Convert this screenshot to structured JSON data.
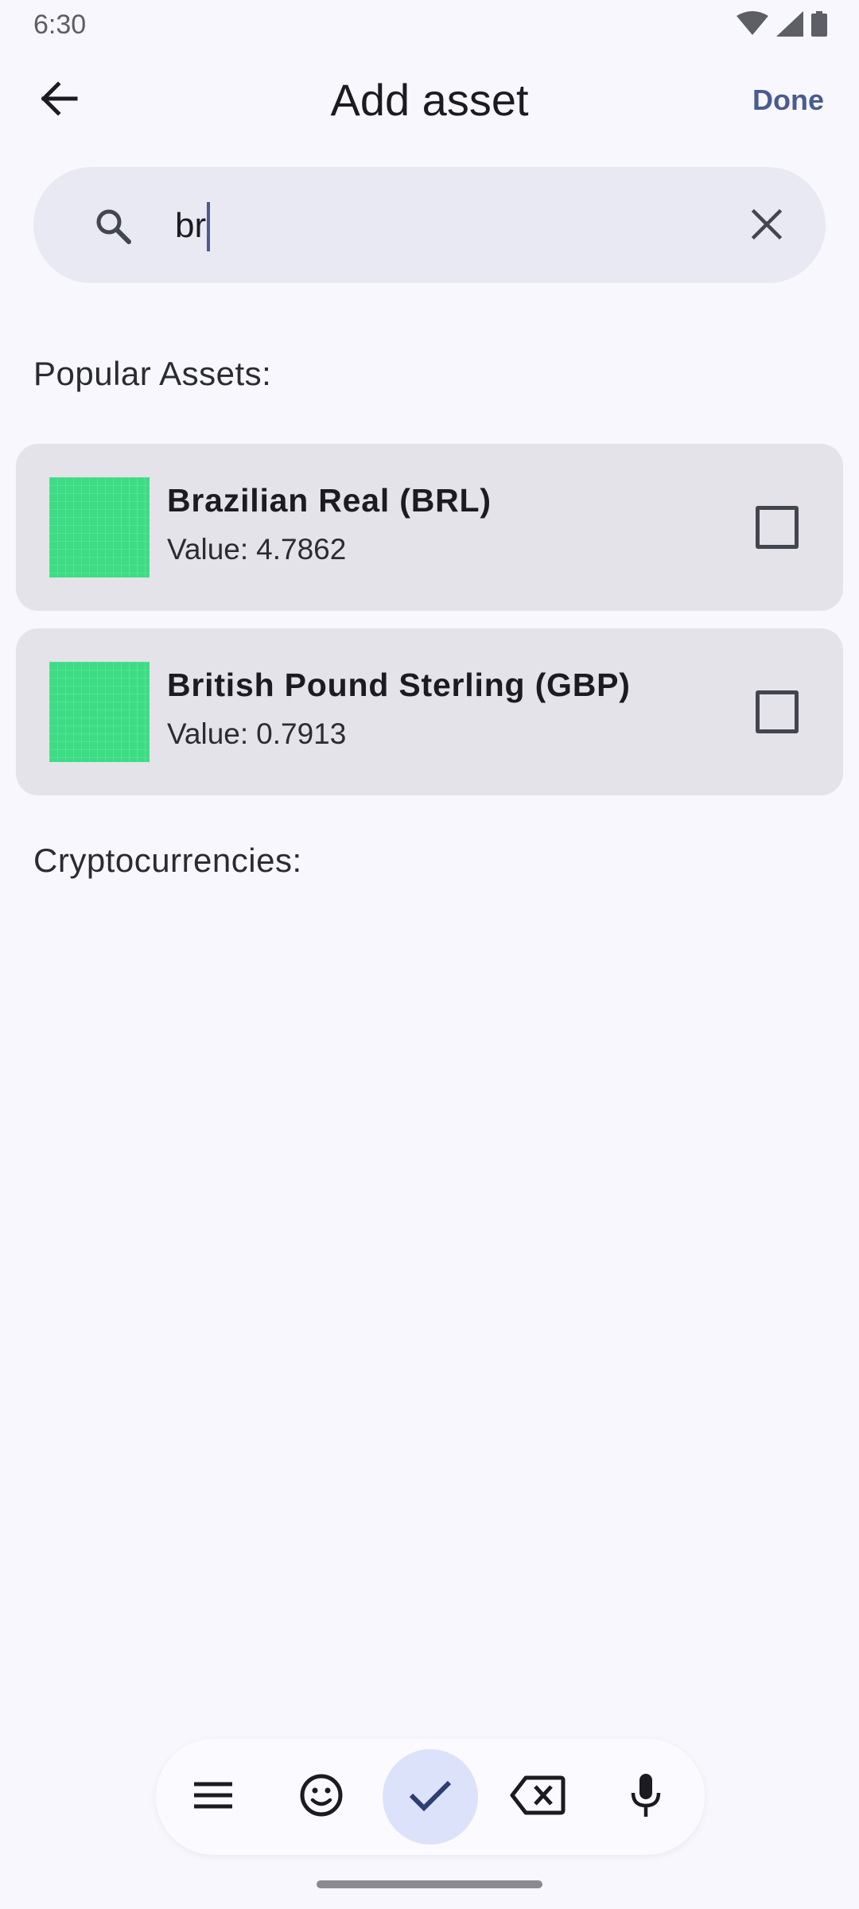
{
  "status_bar": {
    "time": "6:30",
    "icons": [
      "wifi-icon",
      "signal-icon",
      "battery-icon"
    ]
  },
  "app_bar": {
    "title": "Add asset",
    "done_label": "Done",
    "back_icon": "arrow-back-icon"
  },
  "search": {
    "value": "br",
    "search_icon": "search-icon",
    "clear_icon": "close-icon"
  },
  "sections": {
    "popular_label": "Popular Assets:",
    "crypto_label": "Cryptocurrencies:"
  },
  "assets": [
    {
      "name": "Brazilian Real (BRL)",
      "value_label": "Value:",
      "value": "4.7862",
      "checked": false
    },
    {
      "name": "British Pound Sterling (GBP)",
      "value_label": "Value:",
      "value": "0.7913",
      "checked": false
    }
  ],
  "keyboard_toolbar": {
    "icons": [
      "menu-icon",
      "emoji-icon",
      "check-icon",
      "backspace-icon",
      "mic-icon"
    ]
  },
  "colors": {
    "accent": "#4a5b92",
    "background": "#f7f7fd",
    "card": "#e3e3e9",
    "thumb": "#3ddc84",
    "search_bg": "#e8e9f2"
  }
}
